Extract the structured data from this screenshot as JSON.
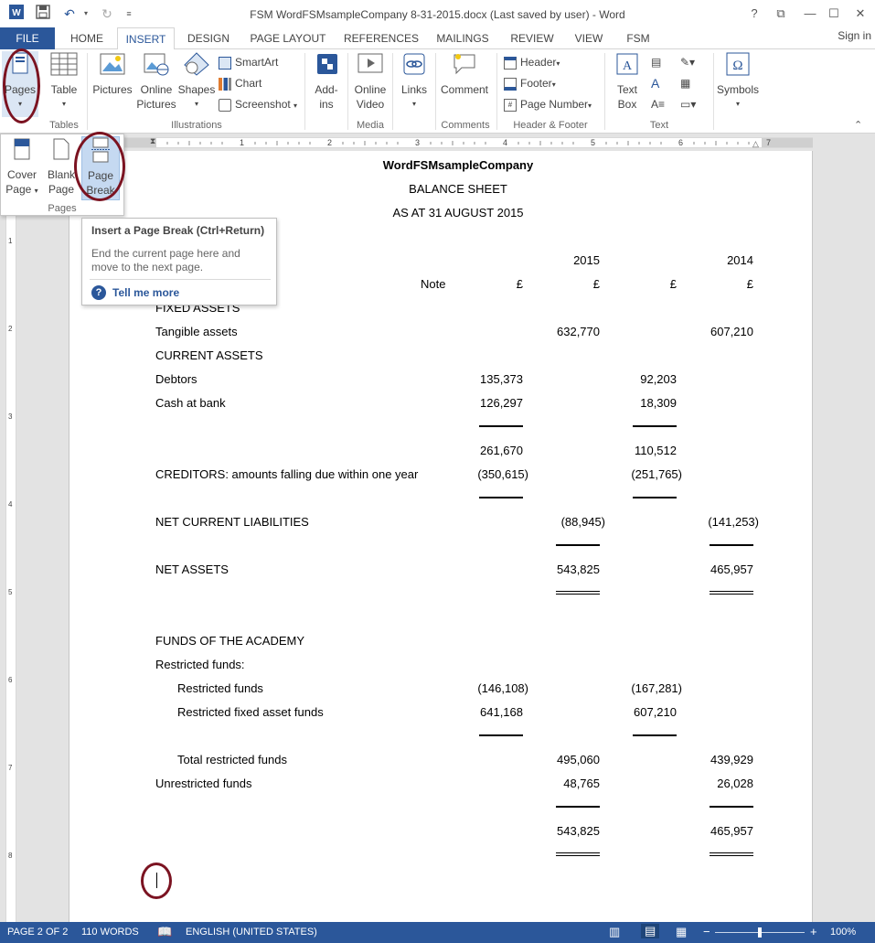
{
  "window": {
    "title": "FSM WordFSMsampleCompany 8-31-2015.docx (Last saved by user) - Word",
    "help": "?",
    "sign_in": "Sign in"
  },
  "tabs": [
    "FILE",
    "HOME",
    "INSERT",
    "DESIGN",
    "PAGE LAYOUT",
    "REFERENCES",
    "MAILINGS",
    "REVIEW",
    "VIEW",
    "FSM"
  ],
  "active_tab": "INSERT",
  "ribbon": {
    "pages": "Pages",
    "table": "Table",
    "tables_group": "Tables",
    "pictures": "Pictures",
    "online_pictures_1": "Online",
    "online_pictures_2": "Pictures",
    "shapes": "Shapes",
    "smartart": "SmartArt",
    "chart": "Chart",
    "screenshot": "Screenshot",
    "illustrations_group": "Illustrations",
    "addins_1": "Add-",
    "addins_2": "ins",
    "online_video_1": "Online",
    "online_video_2": "Video",
    "media_group": "Media",
    "links": "Links",
    "comment": "Comment",
    "comments_group": "Comments",
    "header": "Header",
    "footer": "Footer",
    "page_number": "Page Number",
    "header_footer_group": "Header & Footer",
    "text_box_1": "Text",
    "text_box_2": "Box",
    "text_group": "Text",
    "symbols": "Symbols"
  },
  "pages_dropdown": {
    "cover_1": "Cover",
    "cover_2": "Page",
    "blank_1": "Blank",
    "blank_2": "Page",
    "break_1": "Page",
    "break_2": "Break",
    "group": "Pages"
  },
  "tooltip": {
    "title": "Insert a Page Break (Ctrl+Return)",
    "line1": "End the current page here and",
    "line2": "move to the next page.",
    "more": "Tell me more"
  },
  "ruler_numbers": [
    "1",
    "2",
    "3",
    "4",
    "5",
    "6",
    "7"
  ],
  "vruler_numbers": [
    "1",
    "2",
    "3",
    "4",
    "5",
    "6",
    "7",
    "8"
  ],
  "document": {
    "company": "WordFSMsampleCompany",
    "heading": "BALANCE SHEET",
    "date": "AS AT 31 AUGUST 2015",
    "year_2015": "2015",
    "year_2014": "2014",
    "note": "Note",
    "pound": "£",
    "fixed_assets": "FIXED ASSETS",
    "tangible": "Tangible assets",
    "tangible_2015": "632,770",
    "tangible_2014": "607,210",
    "current_assets": "CURRENT ASSETS",
    "debtors": "Debtors",
    "debtors_2015": "135,373",
    "debtors_2014": "92,203",
    "cash": "Cash at bank",
    "cash_2015": "126,297",
    "cash_2014": "18,309",
    "subtotal_2015": "261,670",
    "subtotal_2014": "110,512",
    "creditors": "CREDITORS: amounts falling due within one year",
    "creditors_2015": "(350,615)",
    "creditors_2014": "(251,765)",
    "ncl": "NET CURRENT LIABILITIES",
    "ncl_2015": "(88,945)",
    "ncl_2014": "(141,253)",
    "net_assets": "NET ASSETS",
    "net_assets_2015": "543,825",
    "net_assets_2014": "465,957",
    "funds": "FUNDS OF THE ACADEMY",
    "restricted_hdr": "Restricted funds:",
    "restricted": "Restricted funds",
    "restricted_2015": "(146,108)",
    "restricted_2014": "(167,281)",
    "restricted_fixed": "Restricted fixed asset funds",
    "restricted_fixed_2015": "641,168",
    "restricted_fixed_2014": "607,210",
    "total_restricted": "Total restricted funds",
    "total_restricted_2015": "495,060",
    "total_restricted_2014": "439,929",
    "unrestricted": "Unrestricted funds",
    "unrestricted_2015": "48,765",
    "unrestricted_2014": "26,028",
    "total_2015": "543,825",
    "total_2014": "465,957"
  },
  "status": {
    "page": "PAGE 2 OF 2",
    "words": "110 WORDS",
    "language": "ENGLISH (UNITED STATES)",
    "zoom": "100%",
    "zoom_minus": "−",
    "zoom_plus": "+"
  },
  "colors": {
    "accent": "#2b579a",
    "highlight_ring": "#7b1321"
  }
}
